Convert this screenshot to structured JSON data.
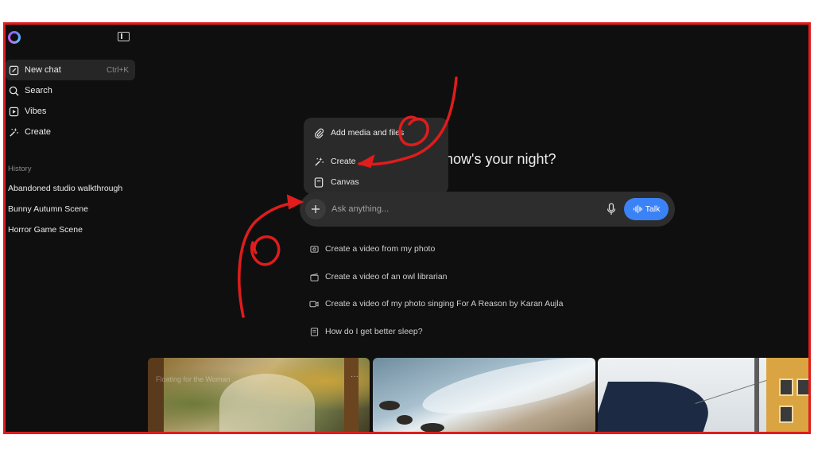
{
  "sidebar": {
    "nav": [
      {
        "label": "New chat",
        "shortcut": "Ctrl+K",
        "icon": "edit-icon"
      },
      {
        "label": "Search",
        "icon": "search-icon"
      },
      {
        "label": "Vibes",
        "icon": "play-icon"
      },
      {
        "label": "Create",
        "icon": "sparkle-wand-icon"
      }
    ],
    "history_title": "History",
    "history": [
      "Abandoned studio walkthrough",
      "Bunny Autumn Scene",
      "Horror Game Scene"
    ]
  },
  "greeting": "how's your night?",
  "popup": {
    "items": [
      {
        "label": "Add media and files",
        "icon": "paperclip-icon"
      },
      {
        "label": "Create",
        "icon": "sparkle-wand-icon"
      },
      {
        "label": "Canvas",
        "icon": "canvas-icon"
      }
    ]
  },
  "composer": {
    "placeholder": "Ask anything...",
    "talk_label": "Talk"
  },
  "suggestions": [
    {
      "label": "Create a video from my photo",
      "icon": "photo-icon"
    },
    {
      "label": "Create a video of an owl librarian",
      "icon": "clapper-icon"
    },
    {
      "label": "Create a video of my photo singing For A Reason by Karan Aujla",
      "icon": "video-icon"
    },
    {
      "label": "How do I get better sleep?",
      "icon": "book-icon"
    }
  ],
  "thumbnails": {
    "caption": "Floating for the Woman ... ",
    "more": "···"
  },
  "colors": {
    "background": "#0f0f0f",
    "accent": "#3b82f6",
    "annotation": "#e01c1c"
  }
}
